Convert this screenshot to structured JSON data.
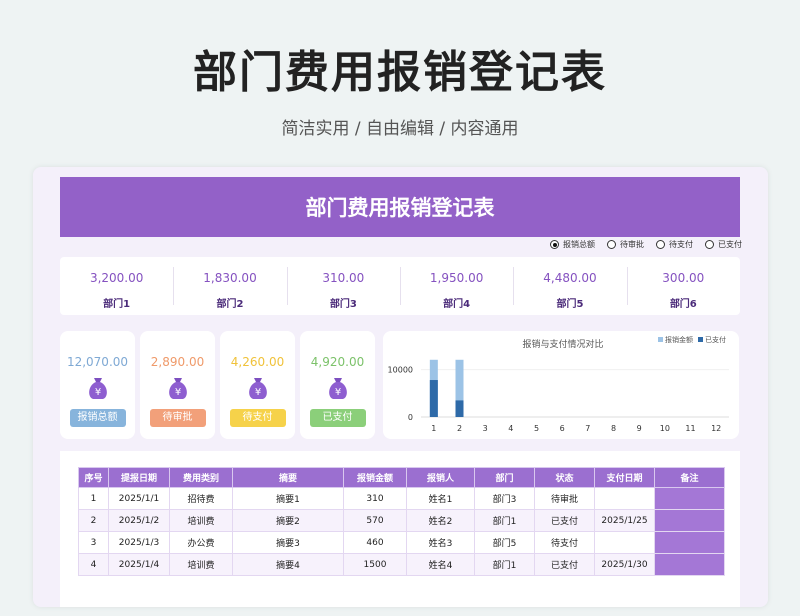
{
  "hero": {
    "title": "部门费用报销登记表",
    "subtitle": "简洁实用 / 自由编辑 / 内容通用"
  },
  "sheet": {
    "banner": "部门费用报销登记表",
    "radios": [
      {
        "label": "报销总额",
        "selected": true
      },
      {
        "label": "待审批",
        "selected": false
      },
      {
        "label": "待支付",
        "selected": false
      },
      {
        "label": "已支付",
        "selected": false
      }
    ],
    "departments": [
      {
        "amount": "3,200.00",
        "name": "部门1"
      },
      {
        "amount": "1,830.00",
        "name": "部门2"
      },
      {
        "amount": "310.00",
        "name": "部门3"
      },
      {
        "amount": "1,950.00",
        "name": "部门4"
      },
      {
        "amount": "4,480.00",
        "name": "部门5"
      },
      {
        "amount": "300.00",
        "name": "部门6"
      }
    ],
    "cards": [
      {
        "value": "12,070.00",
        "label": "报销总额",
        "color": "#87b4dc",
        "value_color": "#7fa9d4",
        "icon": "money-bag-icon"
      },
      {
        "value": "2,890.00",
        "label": "待审批",
        "color": "#f2a07a",
        "value_color": "#ef9a6a",
        "icon": "money-bag-icon"
      },
      {
        "value": "4,260.00",
        "label": "待支付",
        "color": "#f6d24a",
        "value_color": "#f0c23a",
        "icon": "money-bag-icon"
      },
      {
        "value": "4,920.00",
        "label": "已支付",
        "color": "#8bcf7a",
        "value_color": "#7cc26a",
        "icon": "money-bag-icon"
      }
    ],
    "table": {
      "headers": [
        "序号",
        "提报日期",
        "费用类别",
        "摘要",
        "报销金额",
        "报销人",
        "部门",
        "状态",
        "支付日期",
        "备注"
      ],
      "rows": [
        [
          "1",
          "2025/1/1",
          "招待费",
          "摘要1",
          "310",
          "姓名1",
          "部门3",
          "待审批",
          "",
          ""
        ],
        [
          "2",
          "2025/1/2",
          "培训费",
          "摘要2",
          "570",
          "姓名2",
          "部门1",
          "已支付",
          "2025/1/25",
          ""
        ],
        [
          "3",
          "2025/1/3",
          "办公费",
          "摘要3",
          "460",
          "姓名3",
          "部门5",
          "待支付",
          "",
          ""
        ],
        [
          "4",
          "2025/1/4",
          "培训费",
          "摘要4",
          "1500",
          "姓名4",
          "部门1",
          "已支付",
          "2025/1/30",
          ""
        ]
      ]
    }
  },
  "chart_data": {
    "type": "bar",
    "title": "报销与支付情况对比",
    "categories": [
      "1",
      "2",
      "3",
      "4",
      "5",
      "6",
      "7",
      "8",
      "9",
      "10",
      "11",
      "12"
    ],
    "series": [
      {
        "name": "报销金额",
        "color": "#9cc3e6",
        "values": [
          12070,
          12070,
          0,
          0,
          0,
          0,
          0,
          0,
          0,
          0,
          0,
          0
        ]
      },
      {
        "name": "已支付",
        "color": "#2e6aa8",
        "values": [
          7800,
          3500,
          0,
          0,
          0,
          0,
          0,
          0,
          0,
          0,
          0,
          0
        ]
      }
    ],
    "yticks": [
      "10000",
      "0"
    ],
    "ylim": [
      0,
      13500
    ],
    "legend": "top-right"
  }
}
